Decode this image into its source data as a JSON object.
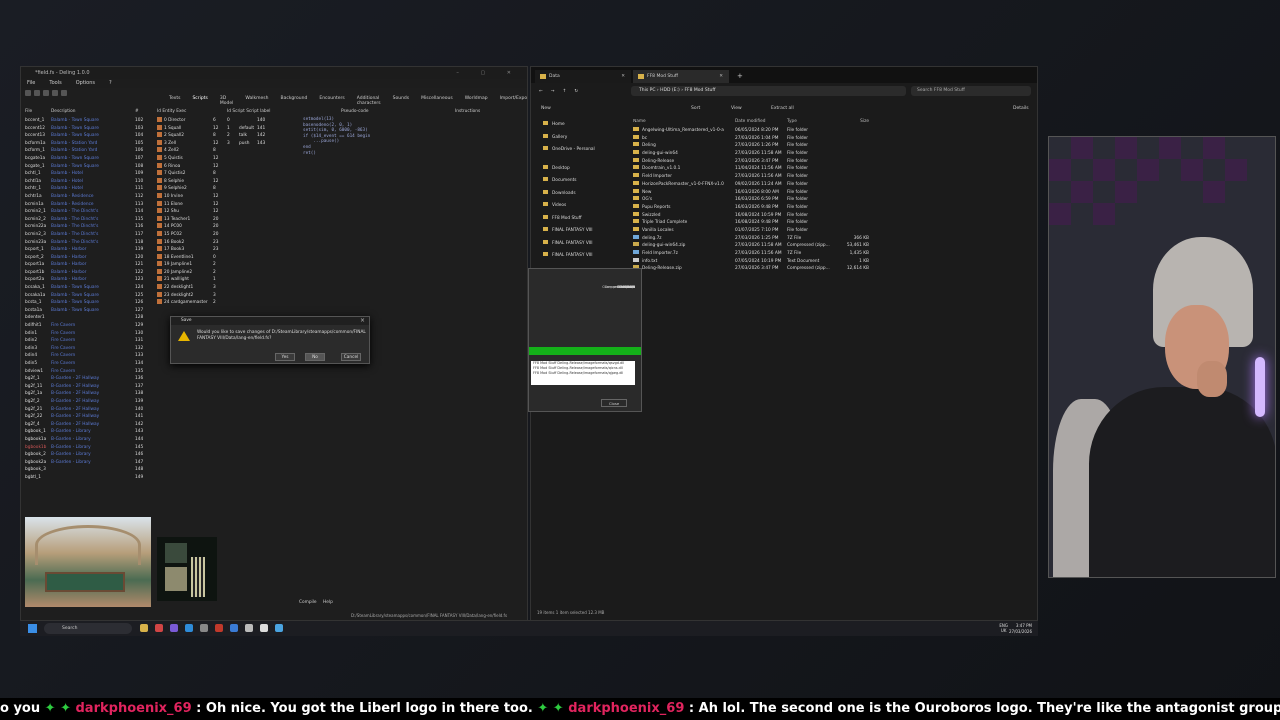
{
  "deling": {
    "title": "*field.fs - Deling 1.0.0",
    "menu": [
      "File",
      "Tools",
      "Options",
      "?"
    ],
    "tabs": [
      "Texts",
      "Scripts",
      "3D Model",
      "Walkmesh",
      "Background",
      "Encounters",
      "Additional characters",
      "Sounds",
      "Miscellaneous",
      "Worldmap",
      "Import/Export"
    ],
    "fields_header": [
      "File",
      "Description",
      "#"
    ],
    "fields": [
      [
        "bccent_1",
        "Balamb - Town Square",
        "102"
      ],
      [
        "bccent12",
        "Balamb - Town Square",
        "103"
      ],
      [
        "bccent13",
        "Balamb - Town Square",
        "104"
      ],
      [
        "bcform1a",
        "Balamb - Station Yard",
        "105"
      ],
      [
        "bcform_1",
        "Balamb - Station Yard",
        "106"
      ],
      [
        "bcgate1a",
        "Balamb - Town Square",
        "107"
      ],
      [
        "bcgate_1",
        "Balamb - Town Square",
        "108"
      ],
      [
        "bchtl_1",
        "Balamb - Hotel",
        "109"
      ],
      [
        "bchtl1a",
        "Balamb - Hotel",
        "110"
      ],
      [
        "bchtr_1",
        "Balamb - Hotel",
        "111"
      ],
      [
        "bchtr1a",
        "Balamb - Residence",
        "112"
      ],
      [
        "bcmin1a",
        "Balamb - Residence",
        "113"
      ],
      [
        "bcmin2_1",
        "Balamb - The Dincht's",
        "114"
      ],
      [
        "bcmin2_2",
        "Balamb - The Dincht's",
        "115"
      ],
      [
        "bcmin22a",
        "Balamb - The Dincht's",
        "116"
      ],
      [
        "bcmin2_3",
        "Balamb - The Dincht's",
        "117"
      ],
      [
        "bcmin23a",
        "Balamb - The Dincht's",
        "118"
      ],
      [
        "bcport_1",
        "Balamb - Harbor",
        "119"
      ],
      [
        "bcport_2",
        "Balamb - Harbor",
        "120"
      ],
      [
        "bcport1a",
        "Balamb - Harbor",
        "121"
      ],
      [
        "bcport1b",
        "Balamb - Harbor",
        "122"
      ],
      [
        "bcport2a",
        "Balamb - Harbor",
        "123"
      ],
      [
        "bcsaka_1",
        "Balamb - Town Square",
        "124"
      ],
      [
        "bcsaka1a",
        "Balamb - Town Square",
        "125"
      ],
      [
        "bcsta_1",
        "Balamb - Town Square",
        "126"
      ],
      [
        "bcsta1a",
        "Balamb - Town Square",
        "127"
      ],
      [
        "bdenter1",
        "",
        "128"
      ],
      [
        "bdifhit1",
        "Fire Cavern",
        "129"
      ],
      [
        "bdin1",
        "Fire Cavern",
        "130"
      ],
      [
        "bdin2",
        "Fire Cavern",
        "131"
      ],
      [
        "bdin3",
        "Fire Cavern",
        "132"
      ],
      [
        "bdin4",
        "Fire Cavern",
        "133"
      ],
      [
        "bdin5",
        "Fire Cavern",
        "134"
      ],
      [
        "bdview1",
        "Fire Cavern",
        "135"
      ],
      [
        "bg2f_1",
        "B-Garden - 2F Hallway",
        "136"
      ],
      [
        "bg2f_11",
        "B-Garden - 2F Hallway",
        "137"
      ],
      [
        "bg2f_1a",
        "B-Garden - 2F Hallway",
        "138"
      ],
      [
        "bg2f_2",
        "B-Garden - 2F Hallway",
        "139"
      ],
      [
        "bg2f_21",
        "B-Garden - 2F Hallway",
        "140"
      ],
      [
        "bg2f_22",
        "B-Garden - 2F Hallway",
        "141"
      ],
      [
        "bg2f_4",
        "B-Garden - 2F Hallway",
        "142"
      ],
      [
        "bgbook_1",
        "B-Garden - Library",
        "143"
      ],
      [
        "bgbook1a",
        "B-Garden - Library",
        "144"
      ],
      [
        "bgbook1b",
        "B-Garden - Library",
        "145"
      ],
      [
        "bgbook_2",
        "B-Garden - Library",
        "146"
      ],
      [
        "bgbook2a",
        "B-Garden - Library",
        "147"
      ],
      [
        "bgbook_3",
        "",
        "148"
      ],
      [
        "bgbtl_1",
        "",
        "149"
      ]
    ],
    "entities_header": [
      "Id",
      "Entity",
      "Exec"
    ],
    "entities": [
      [
        "0",
        "Director",
        "6"
      ],
      [
        "1",
        "Squall",
        "12"
      ],
      [
        "2",
        "Squall2",
        "8"
      ],
      [
        "3",
        "Zell",
        "12"
      ],
      [
        "4",
        "Zell2",
        "8"
      ],
      [
        "5",
        "Quistis",
        "12"
      ],
      [
        "6",
        "Rinoa",
        "12"
      ],
      [
        "7",
        "Quistis2",
        "8"
      ],
      [
        "8",
        "Selphie",
        "12"
      ],
      [
        "9",
        "Selphie2",
        "8"
      ],
      [
        "10",
        "Irvine",
        "12"
      ],
      [
        "11",
        "Elone",
        "12"
      ],
      [
        "12",
        "Shu",
        "12"
      ],
      [
        "13",
        "Teacher1",
        "20"
      ],
      [
        "14",
        "PC00",
        "20"
      ],
      [
        "15",
        "PC02",
        "20"
      ],
      [
        "16",
        "Book2",
        "23"
      ],
      [
        "17",
        "Book3",
        "23"
      ],
      [
        "18",
        "Eventline1",
        "0"
      ],
      [
        "19",
        "Jampline1",
        "2"
      ],
      [
        "20",
        "Jampline2",
        "2"
      ],
      [
        "21",
        "walllight",
        "1"
      ],
      [
        "22",
        "desklight1",
        "3"
      ],
      [
        "23",
        "desklight2",
        "3"
      ],
      [
        "24",
        "cardgamemaster",
        "2"
      ]
    ],
    "scripts_header": [
      "Id",
      "Script",
      "Script label"
    ],
    "scripts": [
      [
        "0",
        "",
        "140"
      ],
      [
        "1",
        "default",
        "141"
      ],
      [
        "2",
        "talk",
        "142"
      ],
      [
        "3",
        "push",
        "143"
      ]
    ],
    "code_header": "Pseudo-code",
    "instr_header": "Instructions",
    "code": "setmodel(13)\nbasenodeno(2, 0, 1)\nsetit(sim, 0, 6000, -863)\nif ($14_event == 614 begin\n    ...pause()\nend\nret()",
    "compile": "Compile",
    "help": "Help",
    "status_path": "D:/SteamLibrary/steamapps/common/FINAL FANTASY VIII/Data/lang-en/field.fs"
  },
  "dialog": {
    "title": "Save",
    "message": "Would you like to save changes of D:/SteamLibrary/steamapps/common/FINAL FANTASY VIII/Data/lang-en/field.fs?",
    "yes": "Yes",
    "no": "No",
    "cancel": "Cancel"
  },
  "explorer": {
    "tabs": [
      "Data",
      "FF8 Mod Stuff"
    ],
    "breadcrumb": [
      "This PC",
      "HDD (E:)",
      "FF8 Mod Stuff"
    ],
    "search": "Search FF8 Mod Stuff",
    "cmd": {
      "new": "New",
      "sort": "Sort",
      "view": "View",
      "extract": "Extract all",
      "details": "Details"
    },
    "nav": [
      "Home",
      "Gallery",
      "OneDrive - Personal",
      "Desktop",
      "Documents",
      "Downloads",
      "Videos",
      "FF8 Mod Stuff",
      "FINAL FANTASY VIII",
      "FINAL FANTASY VIII",
      "FINAL FANTASY VIII",
      "SteamLibrary",
      "Network"
    ],
    "columns": [
      "Name",
      "Date modified",
      "Type",
      "Size"
    ],
    "files": [
      [
        "Angelwing-Ultima_Remastered_v1-0-a",
        "06/05/2024 8:20 PM",
        "File folder",
        ""
      ],
      [
        "bc",
        "27/03/2026 1:04 PM",
        "File folder",
        ""
      ],
      [
        "Deling",
        "27/03/2026 1:26 PM",
        "File folder",
        ""
      ],
      [
        "deling-gui-win64",
        "27/03/2026 11:58 AM",
        "File folder",
        ""
      ],
      [
        "Deling-Release",
        "27/03/2026 3:47 PM",
        "File folder",
        ""
      ],
      [
        "Doomtrain_v1.0.1",
        "11/04/2024 11:56 AM",
        "File folder",
        ""
      ],
      [
        "Field Importer",
        "27/03/2026 11:56 AM",
        "File folder",
        ""
      ],
      [
        "HorizonPackRemaster_v1-0-FFNX-v1.0",
        "09/02/2026 11:24 AM",
        "File folder",
        ""
      ],
      [
        "New",
        "16/03/2026 8:00 AM",
        "File folder",
        ""
      ],
      [
        "OG's",
        "16/03/2026 6:59 PM",
        "File folder",
        ""
      ],
      [
        "Pupu Reports",
        "16/03/2026 9:48 PM",
        "File folder",
        ""
      ],
      [
        "Swizzled",
        "16/08/2024 10:59 PM",
        "File folder",
        ""
      ],
      [
        "Triple Triad Complete",
        "16/08/2024 9:48 PM",
        "File folder",
        ""
      ],
      [
        "Vanilla Locales",
        "01/07/2025 7:10 PM",
        "File folder",
        ""
      ],
      [
        "deling.7z",
        "27/03/2026 1:25 PM",
        "7Z File",
        "366 KB"
      ],
      [
        "deling-gui-win64.zip",
        "27/03/2026 11:58 AM",
        "Compressed (zipp...",
        "53,461 KB"
      ],
      [
        "Field Importer.7z",
        "27/03/2026 11:56 AM",
        "7Z File",
        "1,435 KB"
      ],
      [
        "info.txt",
        "07/05/2024 10:19 PM",
        "Text Document",
        "1 KB"
      ],
      [
        "Deling-Release.zip",
        "27/03/2026 3:47 PM",
        "Compressed (zipp...",
        "12,614 KB"
      ]
    ],
    "status": "19 items   1 item selected  12.3 MB"
  },
  "progress": {
    "title": "",
    "stats": [
      [
        "Total size",
        "25002 KB"
      ],
      [
        "Speed",
        "16 MB/s"
      ],
      [
        "Processed",
        "25002 KB"
      ],
      [
        "Compressed size",
        "12617 KB"
      ],
      [
        "Compression ratio",
        "42%"
      ]
    ],
    "fill_percent": 100,
    "log": [
      "FF8 Mod Stuff Deling-Release/imageformats/qsvgd.dll",
      "FF8 Mod Stuff Deling-Release/imageformats/qicns.dll",
      "FF8 Mod Stuff Deling-Release/imageformats/qjpeg.dll"
    ],
    "close": "Close"
  },
  "taskbar": {
    "search": "Search",
    "lang": "ENG",
    "region": "UK",
    "time": "3:47 PM",
    "date": "27/03/2026"
  },
  "ticker": {
    "lead": "o you",
    "user1": "darkphoenix_69",
    "msg1": ": Oh nice. You got the Liberl logo in there too.",
    "user2": "darkphoenix_69",
    "msg2": ": Ah lol. The second one is the Ouroboros logo. They're like the antagonist group of the series."
  }
}
